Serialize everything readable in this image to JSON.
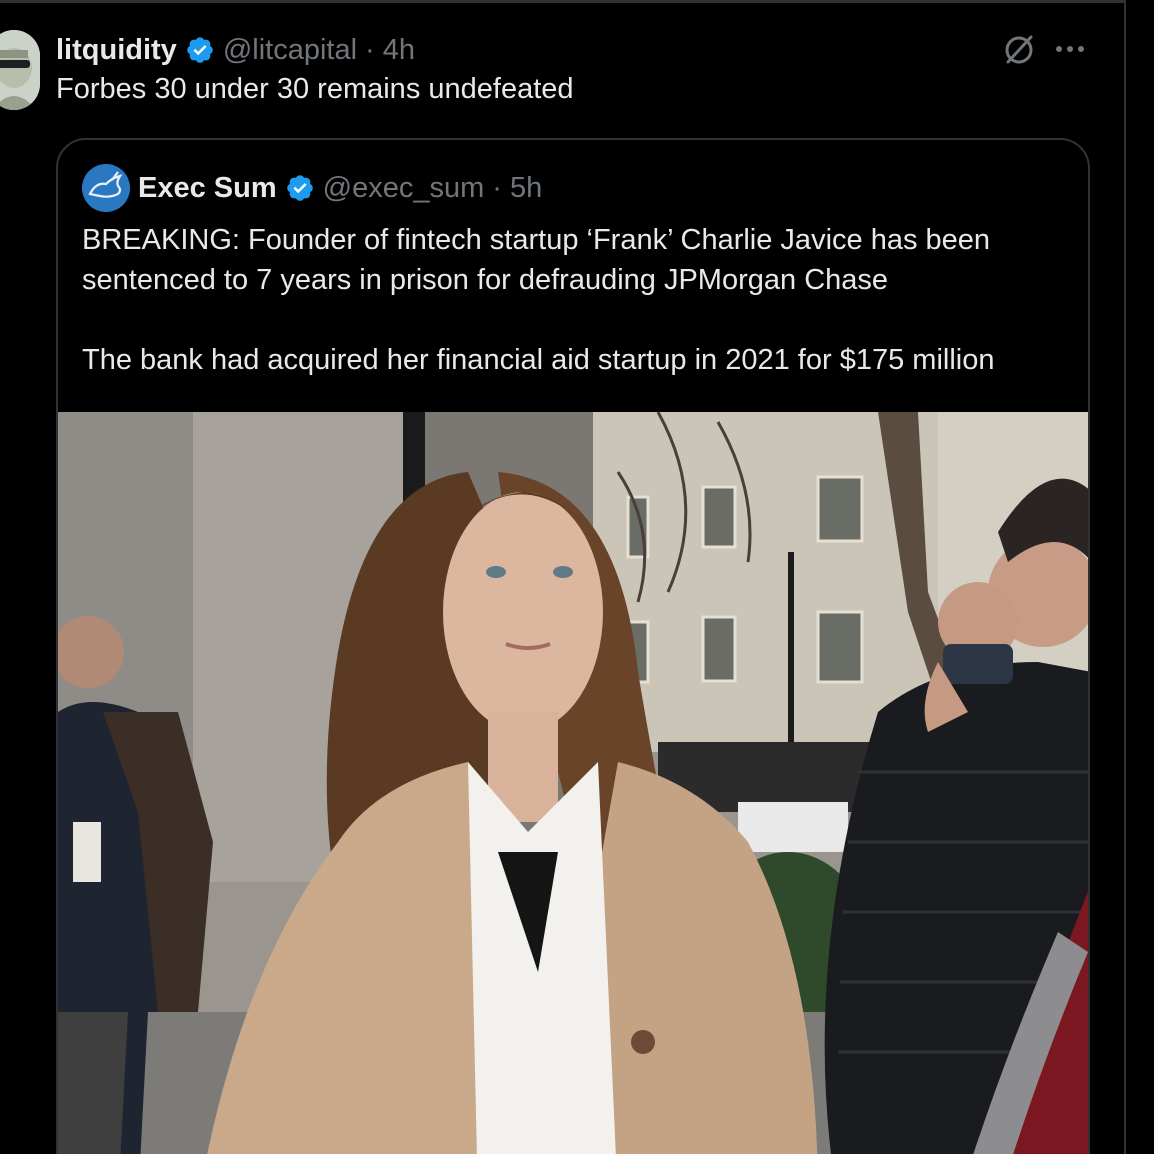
{
  "post": {
    "display_name": "litquidity",
    "handle": "@litcapital",
    "separator": "·",
    "time": "4h",
    "text": "Forbes 30 under 30 remains undefeated"
  },
  "quote": {
    "display_name": "Exec Sum",
    "handle": "@exec_sum",
    "separator": "·",
    "time": "5h",
    "line1": "BREAKING: Founder of fintech startup ‘Frank’ Charlie Javice has been",
    "line2": "sentenced to 7 years in prison for defrauding JPMorgan Chase",
    "line3": "The bank had acquired her financial aid startup in 2021 for $175 million"
  },
  "icons": {
    "verified": "verified-badge-icon",
    "grok": "grok-icon",
    "more": "more-options-icon"
  },
  "colors": {
    "background": "#000000",
    "text_primary": "#e7e9ea",
    "text_secondary": "#71767b",
    "verified": "#1d9bf0",
    "border": "#2f3336"
  }
}
